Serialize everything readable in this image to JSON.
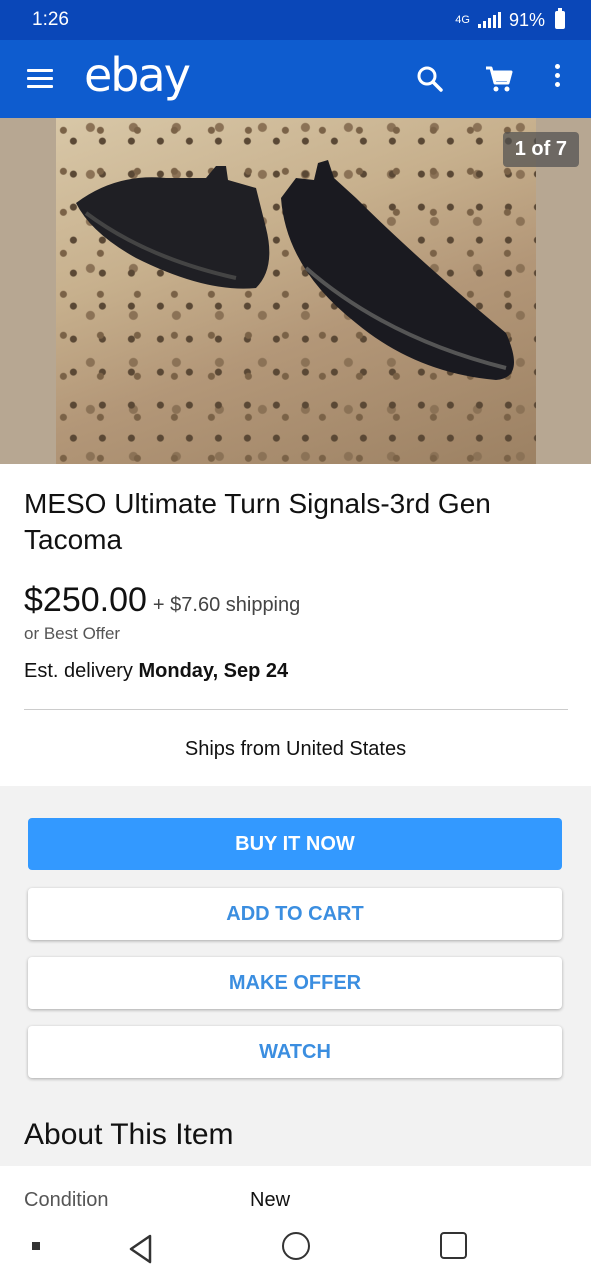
{
  "status_bar": {
    "time": "1:26",
    "network": "4G",
    "battery": "91%"
  },
  "app_bar": {
    "brand": "ebay"
  },
  "gallery": {
    "counter": "1 of 7"
  },
  "item": {
    "title": "MESO Ultimate Turn Signals-3rd Gen Tacoma",
    "price": "$250.00",
    "shipping": "+ $7.60 shipping",
    "best_offer": "or Best Offer",
    "delivery_prefix": "Est. delivery",
    "delivery_date": "Monday, Sep 24",
    "ships_from": "Ships from United States"
  },
  "actions": {
    "buy_now": "BUY IT NOW",
    "add_to_cart": "ADD TO CART",
    "make_offer": "MAKE OFFER",
    "watch": "WATCH"
  },
  "about": {
    "heading": "About This Item",
    "condition_label": "Condition",
    "condition_value": "New"
  },
  "colors": {
    "status_bar": "#0a47b8",
    "app_bar": "#0e5ccf",
    "primary_button": "#3399ff",
    "secondary_text": "#3b8ee0"
  }
}
